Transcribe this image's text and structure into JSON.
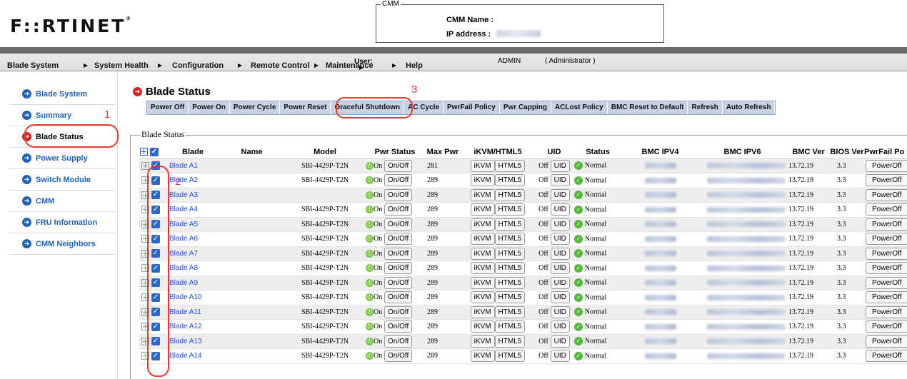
{
  "header": {
    "logo_text": "F::RTINET",
    "cmm_legend": "CMM",
    "cmm_name_label": "CMM Name :",
    "ip_label": "IP address :"
  },
  "menu": {
    "items": [
      "Blade System",
      "System Health",
      "Configuration",
      "Remote Control",
      "Maintenance",
      "Help"
    ],
    "user_label": "User:",
    "user_name": "ADMIN",
    "user_role": "( Administrator )"
  },
  "sidebar": {
    "items": [
      {
        "label": "Blade System",
        "active": false
      },
      {
        "label": "Summary",
        "active": false
      },
      {
        "label": "Blade Status",
        "active": true
      },
      {
        "label": "Power Supply",
        "active": false
      },
      {
        "label": "Switch Module",
        "active": false
      },
      {
        "label": "CMM",
        "active": false
      },
      {
        "label": "FRU Information",
        "active": false
      },
      {
        "label": "CMM Neighbors",
        "active": false
      }
    ]
  },
  "annotations": {
    "one": "1",
    "two": "2",
    "three": "3"
  },
  "main": {
    "title": "Blade Status",
    "fieldset_legend": "Blade Status",
    "actions": [
      "Power Off",
      "Power On",
      "Power Cycle",
      "Power Reset",
      "Graceful Shutdown",
      "AC Cycle",
      "PwrFail Policy",
      "Pwr Capping",
      "ACLost Policy",
      "BMC Reset to Default",
      "Refresh",
      "Auto Refresh"
    ]
  },
  "table": {
    "headers": [
      "Blade",
      "Name",
      "Model",
      "Pwr Status",
      "Max Pwr",
      "iKVM/HTML5",
      "UID",
      "Status",
      "BMC IPV4",
      "BMC IPV6",
      "BMC Ver",
      "BIOS Ver",
      "PwrFail Po"
    ],
    "pwr_on_text": "On",
    "onoff_label": "On/Off",
    "ikvm_label": "iKVM",
    "html5_label": "HTML5",
    "uid_off_text": "Off",
    "uid_label": "UID",
    "status_text": "Normal",
    "pwrfail_label": "PowerOff",
    "rows": [
      {
        "blade": "Blade A1",
        "model": "SBI-4429P-T2N",
        "max_pwr": "281",
        "bmc_ver": "13.72.19",
        "bios_ver": "3.3"
      },
      {
        "blade": "Blade A2",
        "model": "SBI-4429P-T2N",
        "max_pwr": "289",
        "bmc_ver": "13.72.19",
        "bios_ver": "3.3"
      },
      {
        "blade": "Blade A3",
        "model": "",
        "max_pwr": "289",
        "bmc_ver": "13.72.19",
        "bios_ver": "3.3"
      },
      {
        "blade": "Blade A4",
        "model": "SBI-4429P-T2N",
        "max_pwr": "289",
        "bmc_ver": "13.72.19",
        "bios_ver": "3.3"
      },
      {
        "blade": "Blade A5",
        "model": "SBI-4429P-T2N",
        "max_pwr": "289",
        "bmc_ver": "13.72.19",
        "bios_ver": "3.3"
      },
      {
        "blade": "Blade A6",
        "model": "SBI-4429P-T2N",
        "max_pwr": "289",
        "bmc_ver": "13.72.19",
        "bios_ver": "3.3"
      },
      {
        "blade": "Blade A7",
        "model": "SBI-4429P-T2N",
        "max_pwr": "289",
        "bmc_ver": "13.72.19",
        "bios_ver": "3.3"
      },
      {
        "blade": "Blade A8",
        "model": "SBI-4429P-T2N",
        "max_pwr": "289",
        "bmc_ver": "13.72.19",
        "bios_ver": "3.3"
      },
      {
        "blade": "Blade A9",
        "model": "SBI-4429P-T2N",
        "max_pwr": "289",
        "bmc_ver": "13.72.19",
        "bios_ver": "3.3"
      },
      {
        "blade": "Blade A10",
        "model": "SBI-4429P-T2N",
        "max_pwr": "289",
        "bmc_ver": "13.72.19",
        "bios_ver": "3.3"
      },
      {
        "blade": "Blade A11",
        "model": "SBI-4429P-T2N",
        "max_pwr": "289",
        "bmc_ver": "13.72.19",
        "bios_ver": "3.3"
      },
      {
        "blade": "Blade A12",
        "model": "SBI-4429P-T2N",
        "max_pwr": "289",
        "bmc_ver": "13.72.19",
        "bios_ver": "3.3"
      },
      {
        "blade": "Blade A13",
        "model": "SBI-4429P-T2N",
        "max_pwr": "289",
        "bmc_ver": "13.72.19",
        "bios_ver": "3.3"
      },
      {
        "blade": "Blade A14",
        "model": "SBI-4429P-T2N",
        "max_pwr": "289",
        "bmc_ver": "13.72.19",
        "bios_ver": "3.3"
      }
    ]
  },
  "colors": {
    "accent_red": "#e53a30",
    "link_blue": "#1f4fd6",
    "nav_blue": "#1f63b7",
    "checkbox_blue": "#2d68c4"
  }
}
